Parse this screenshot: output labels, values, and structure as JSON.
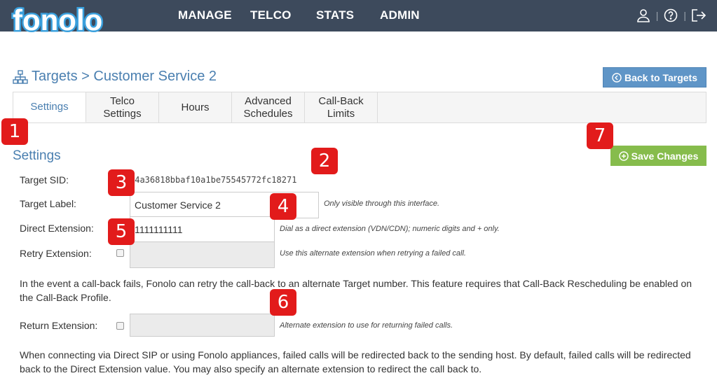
{
  "brand": {
    "logo_text": "fonolo"
  },
  "nav": {
    "items": [
      "MANAGE",
      "TELCO",
      "STATS",
      "ADMIN"
    ]
  },
  "header_icons": [
    "user-icon",
    "help-icon",
    "logout-icon"
  ],
  "breadcrumb": {
    "text": "Targets > Customer Service 2"
  },
  "buttons": {
    "back": "Back to Targets",
    "save": "Save Changes"
  },
  "tabs": [
    {
      "label": "Settings",
      "active": true
    },
    {
      "label": "Telco\nSettings",
      "active": false
    },
    {
      "label": "Hours",
      "active": false
    },
    {
      "label": "Advanced\nSchedules",
      "active": false
    },
    {
      "label": "Call-Back\nLimits",
      "active": false
    }
  ],
  "section": {
    "title": "Settings"
  },
  "fields": {
    "sid": {
      "label": "Target SID:",
      "value": "R4a36818bbaf10a1be75545772fc18271"
    },
    "target_label": {
      "label": "Target Label:",
      "value": "Customer Service 2",
      "hint": "Only visible through this interface."
    },
    "direct_extension": {
      "label": "Direct Extension:",
      "value": "1111111111",
      "hint": "Dial as a direct extension (VDN/CDN); numeric digits and + only."
    },
    "retry_extension": {
      "label": "Retry Extension:",
      "value": "",
      "checked": false,
      "hint": "Use this alternate extension when retrying a failed call."
    },
    "return_extension": {
      "label": "Return Extension:",
      "value": "",
      "checked": false,
      "hint": "Alternate extension to use for returning failed calls."
    }
  },
  "paragraphs": {
    "retry_info": "In the event a call-back fails, Fonolo can retry the call-back to an alternate Target number. This feature requires that Call-Back Rescheduling be enabled on the Call-Back Profile.",
    "return_info": "When connecting via Direct SIP or using Fonolo appliances, failed calls will be redirected back to the sending host. By default, failed calls will be redirected back to the Direct Extension value. You may also specify an alternate extension to redirect the call back to."
  },
  "annotations": [
    "1",
    "2",
    "3",
    "4",
    "5",
    "6",
    "7"
  ],
  "colors": {
    "topbar": "#3d4a5c",
    "accent_blue": "#4a7fb0",
    "back_button": "#5f95c7",
    "save_button": "#86bc4c",
    "badge_red": "#e21b1b"
  }
}
